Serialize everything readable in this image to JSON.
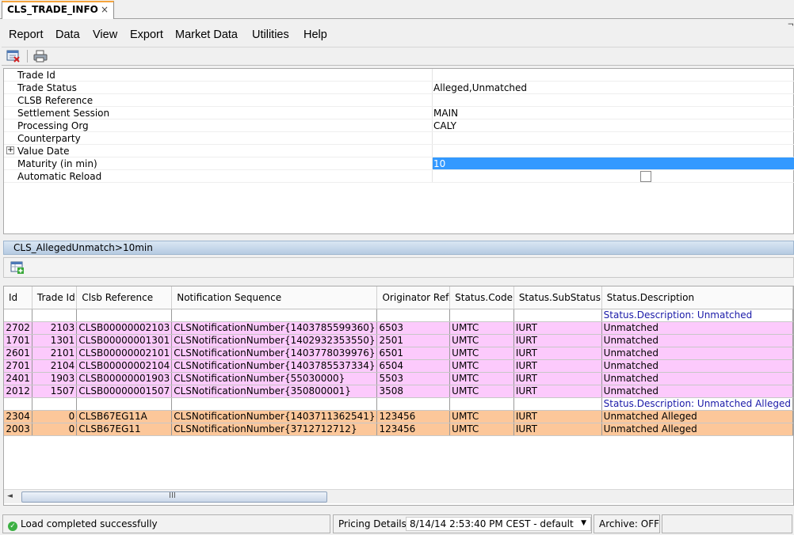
{
  "tab": {
    "title": "CLS_TRADE_INFO",
    "close": "×"
  },
  "corner_mark": "¬",
  "menu": [
    "Report",
    "Data",
    "View",
    "Export",
    "Market Data",
    "Utilities",
    "Help"
  ],
  "properties": [
    {
      "label": "Trade Id",
      "value": ""
    },
    {
      "label": "Trade Status",
      "value": "Alleged,Unmatched"
    },
    {
      "label": "CLSB Reference",
      "value": ""
    },
    {
      "label": "Settlement Session",
      "value": " MAIN"
    },
    {
      "label": "Processing Org",
      "value": "CALY"
    },
    {
      "label": "Counterparty",
      "value": ""
    },
    {
      "label": "Value Date",
      "value": "",
      "expandable": true,
      "expand_symbol": "+"
    },
    {
      "label": "Maturity (in min)",
      "value": "10",
      "selected": true
    },
    {
      "label": "Automatic Reload",
      "value": "",
      "checkbox": true,
      "checked": false
    }
  ],
  "report_title": "CLS_AllegedUnmatch>10min",
  "grid": {
    "columns": [
      "Id",
      "Trade Id",
      "Clsb Reference",
      "Notification Sequence",
      "Originator Ref",
      "Status.Code",
      "Status.SubStatus",
      "Status.Description"
    ],
    "groups": [
      {
        "label": "Status.Description: Unmatched",
        "color": "#fccafc",
        "rows": [
          [
            "2702",
            "2103",
            "CLSB00000002103",
            "CLSNotificationNumber{1403785599360}",
            "6503",
            "UMTC",
            "IURT",
            "Unmatched"
          ],
          [
            "1701",
            "1301",
            "CLSB00000001301",
            "CLSNotificationNumber{1402932353550}",
            "2501",
            "UMTC",
            "IURT",
            "Unmatched"
          ],
          [
            "2601",
            "2101",
            "CLSB00000002101",
            "CLSNotificationNumber{1403778039976}",
            "6501",
            "UMTC",
            "IURT",
            "Unmatched"
          ],
          [
            "2701",
            "2104",
            "CLSB00000002104",
            "CLSNotificationNumber{1403785537334}",
            "6504",
            "UMTC",
            "IURT",
            "Unmatched"
          ],
          [
            "2401",
            "1903",
            "CLSB00000001903",
            "CLSNotificationNumber{55030000}",
            "5503",
            "UMTC",
            "IURT",
            "Unmatched"
          ],
          [
            "2012",
            "1507",
            "CLSB00000001507",
            "CLSNotificationNumber{350800001}",
            "3508",
            "UMTC",
            "IURT",
            "Unmatched"
          ]
        ]
      },
      {
        "label": "Status.Description: Unmatched Alleged",
        "color": "#fcc79a",
        "rows": [
          [
            "2304",
            "0",
            "CLSB67EG11A",
            "CLSNotificationNumber{1403711362541}",
            "123456",
            "UMTC",
            "IURT",
            "Unmatched Alleged"
          ],
          [
            "2003",
            "0",
            "CLSB67EG11",
            "CLSNotificationNumber{3712712712}",
            "123456",
            "UMTC",
            "IURT",
            "Unmatched Alleged"
          ]
        ]
      }
    ]
  },
  "scrollbar": {
    "left_arrow": "◄",
    "grip": "III"
  },
  "status": {
    "message": "Load completed successfully",
    "ok_glyph": "✓",
    "pricing_label": "Pricing Details:",
    "pricing_value": "8/14/14 2:53:40 PM CEST - default",
    "pricing_arrow": "▼",
    "archive": "Archive: OFF"
  }
}
